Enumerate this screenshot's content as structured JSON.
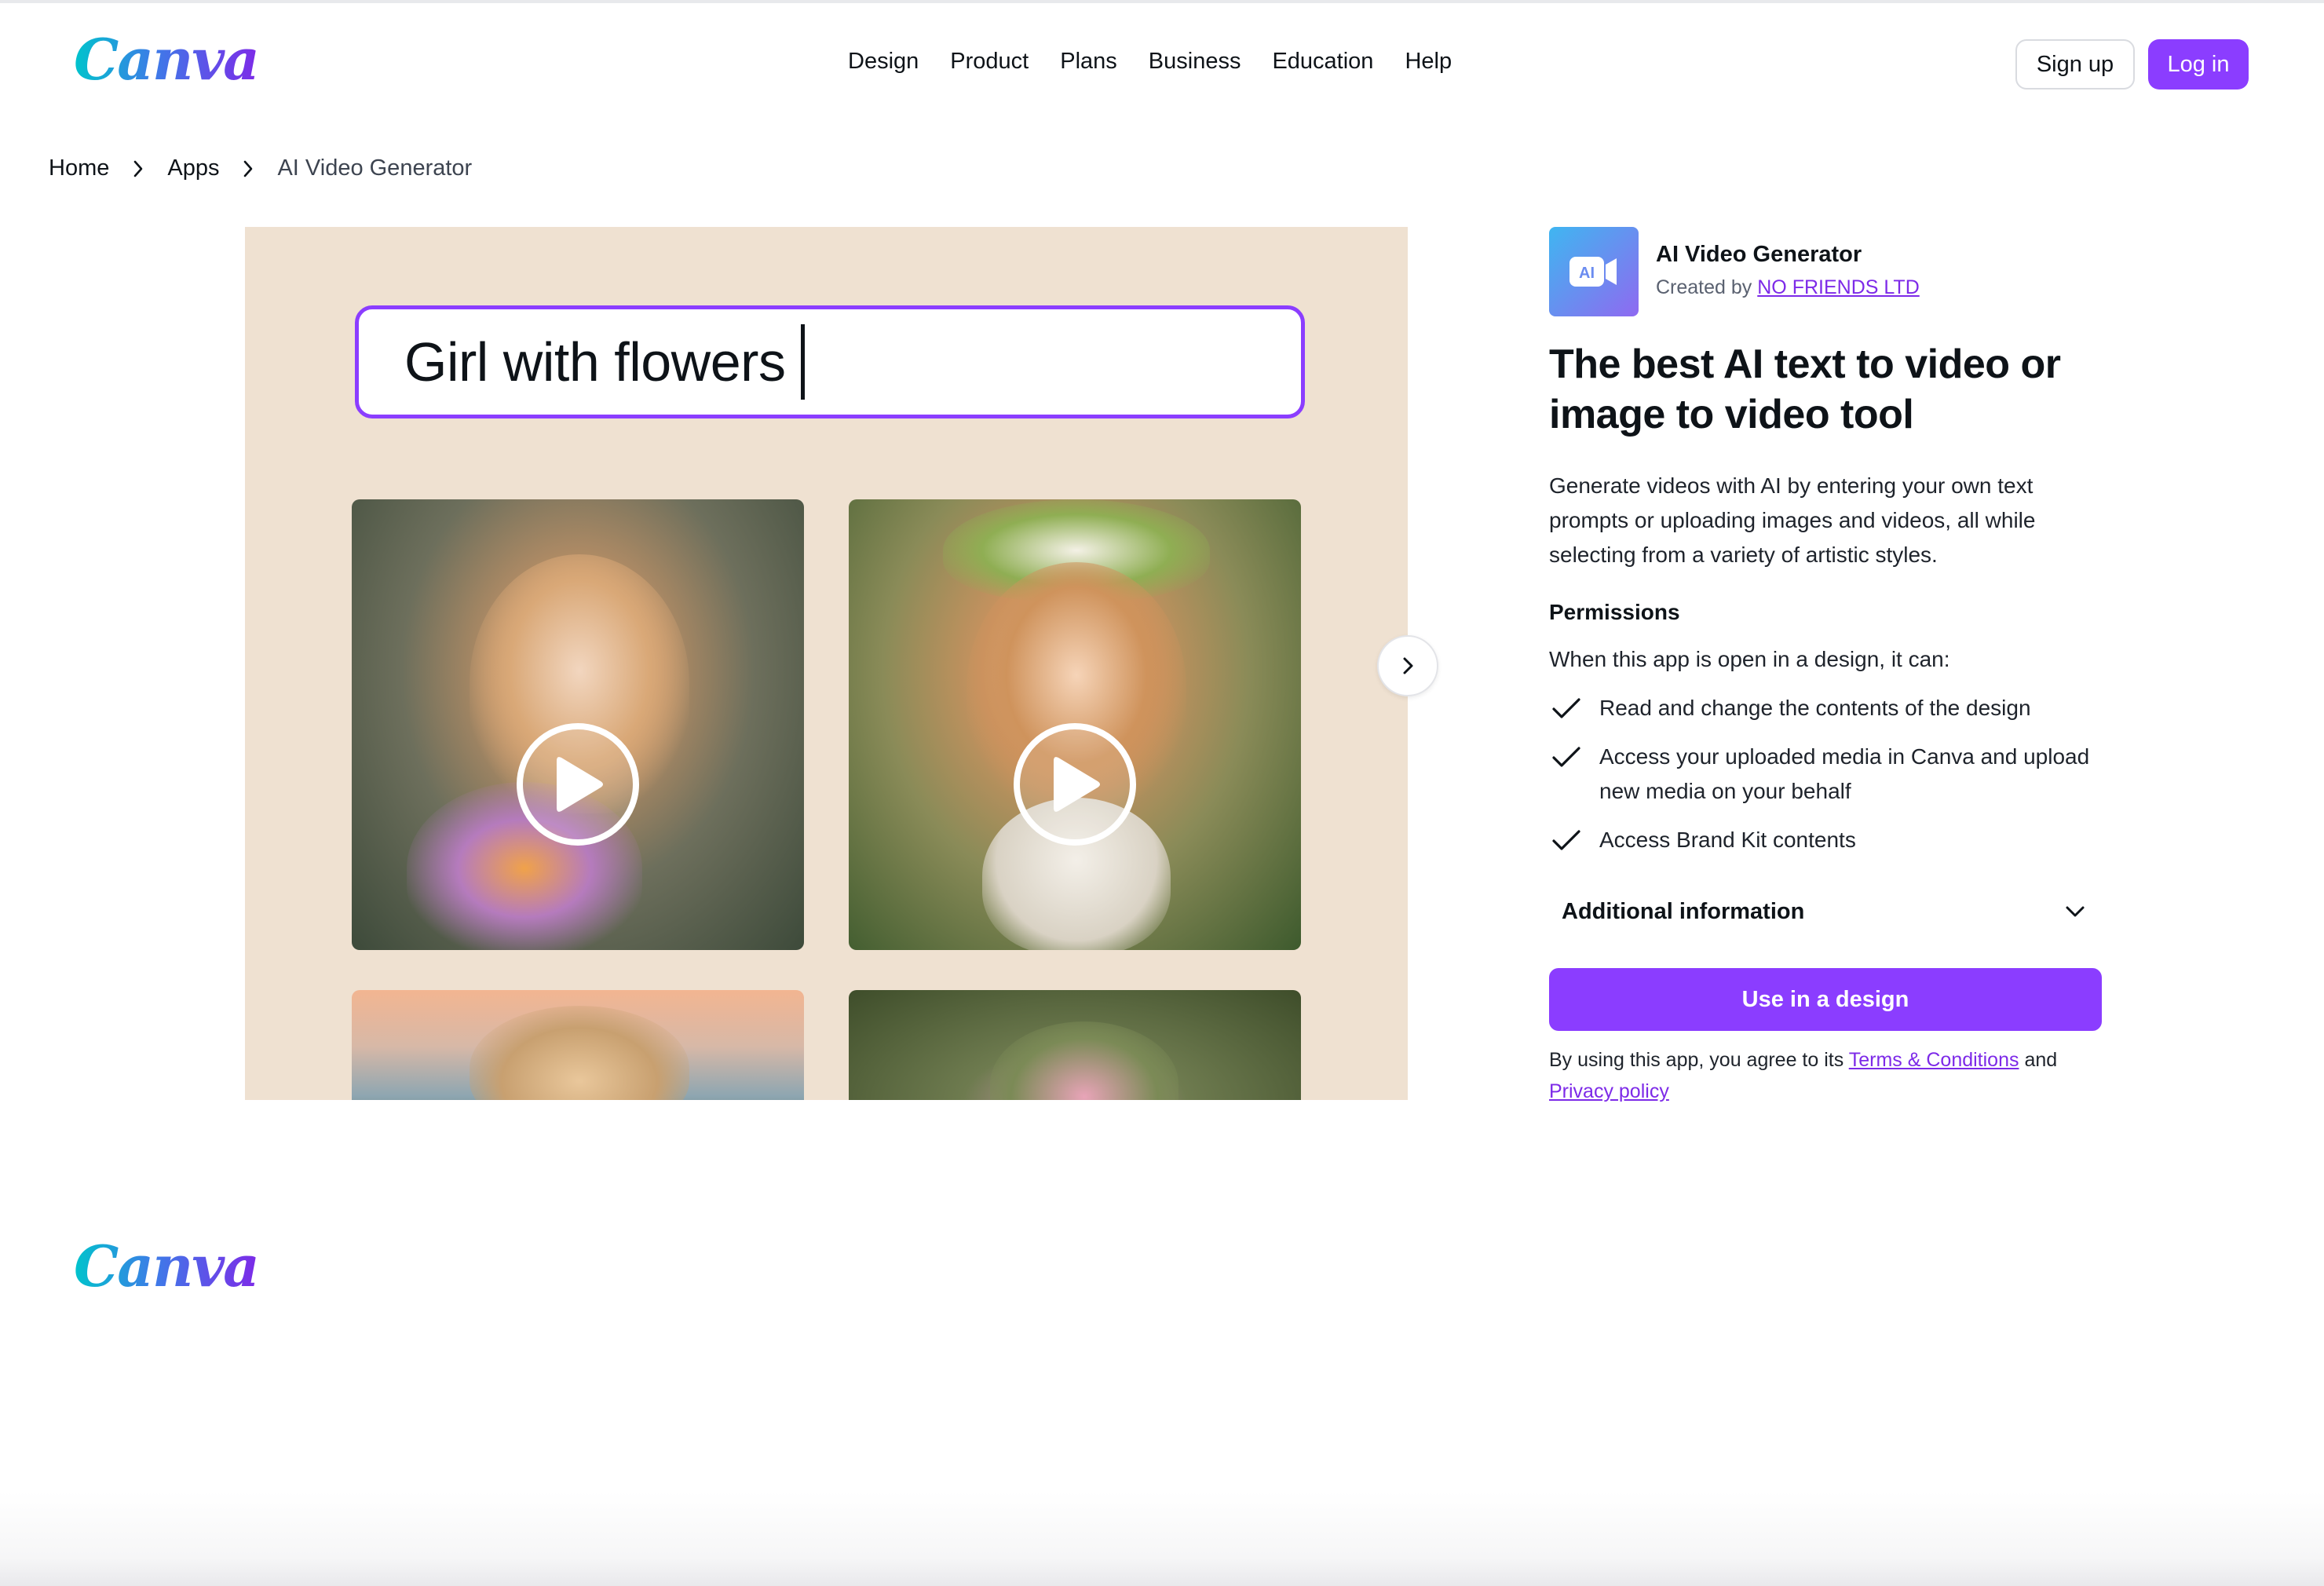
{
  "header": {
    "logo_text": "Canva",
    "nav": [
      "Design",
      "Product",
      "Plans",
      "Business",
      "Education",
      "Help"
    ],
    "signup_label": "Sign up",
    "login_label": "Log in"
  },
  "breadcrumb": {
    "items": [
      "Home",
      "Apps",
      "AI Video Generator"
    ]
  },
  "media": {
    "prompt_text": "Girl with flowers"
  },
  "app": {
    "icon_text": "AI",
    "name": "AI Video Generator",
    "created_by_prefix": "Created by",
    "creator": "NO FRIENDS LTD",
    "title": "The best AI text to video or image to video tool",
    "description": "Generate videos with AI by entering your own text prompts or uploading images and videos, all while selecting from a variety of artistic styles.",
    "permissions_heading": "Permissions",
    "permissions_intro": "When this app is open in a design, it can:",
    "permissions": [
      "Read and change the contents of the design",
      "Access your uploaded media in Canva and upload new media on your behalf",
      "Access Brand Kit contents"
    ],
    "additional_info_label": "Additional information",
    "use_button_label": "Use in a design",
    "terms_prefix": "By using this app, you agree to its",
    "terms_link": "Terms & Conditions",
    "terms_and": "and",
    "privacy_link": "Privacy policy"
  },
  "footer": {
    "logo_text": "Canva"
  },
  "colors": {
    "accent": "#8b3dff",
    "link": "#7d2ae8",
    "panel_bg": "#efe1d1"
  }
}
